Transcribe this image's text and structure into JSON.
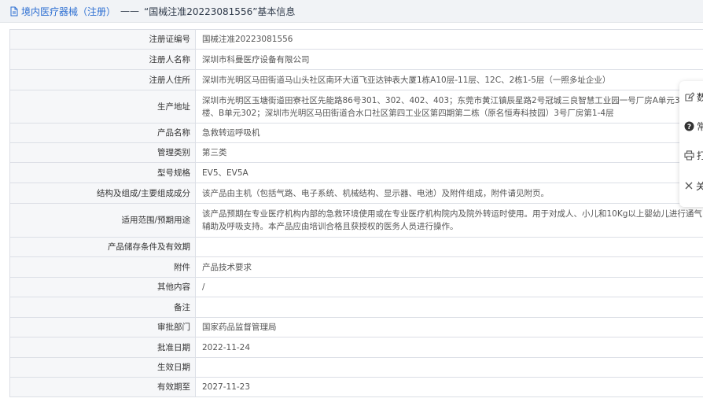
{
  "breadcrumb": {
    "category": "境内医疗器械（注册）",
    "separator": "——",
    "title": "“国械注准20223081556”基本信息"
  },
  "rows": [
    {
      "label": "注册证编号",
      "value": "国械注准20223081556"
    },
    {
      "label": "注册人名称",
      "value": "深圳市科曼医疗设备有限公司"
    },
    {
      "label": "注册人住所",
      "value": "深圳市光明区马田街道马山头社区南环大道飞亚达钟表大厦1栋A10层-11层、12C、2栋1-5层（一照多址企业）"
    },
    {
      "label": "生产地址",
      "value": "深圳市光明区玉塘街道田寮社区先能路86号301、302、402、403；东莞市黄江镇辰星路2号冠城三良智慧工业园一号厂房A单元3楼、4楼、B单元302；深圳市光明区马田街道合水口社区第四工业区第四期第二栋（原名恒寿科技园）3号厂房第1-4层"
    },
    {
      "label": "产品名称",
      "value": "急救转运呼吸机"
    },
    {
      "label": "管理类别",
      "value": "第三类"
    },
    {
      "label": "型号规格",
      "value": "EV5、EV5A"
    },
    {
      "label": "结构及组成/主要组成成分",
      "value": "该产品由主机（包括气路、电子系统、机械结构、显示器、电池）及附件组成，附件请见附页。"
    },
    {
      "label": "适用范围/预期用途",
      "value": "该产品预期在专业医疗机构内部的急救环境使用或在专业医疗机构院内及院外转运时使用。用于对成人、小儿和10Kg以上婴幼儿进行通气辅助及呼吸支持。本产品应由培训合格且获授权的医务人员进行操作。"
    },
    {
      "label": "产品储存条件及有效期",
      "value": ""
    },
    {
      "label": "附件",
      "value": "产品技术要求"
    },
    {
      "label": "其他内容",
      "value": "/"
    },
    {
      "label": "备注",
      "value": ""
    },
    {
      "label": "审批部门",
      "value": "国家药品监督管理局"
    },
    {
      "label": "批准日期",
      "value": "2022-11-24"
    },
    {
      "label": "生效日期",
      "value": ""
    },
    {
      "label": "有效期至",
      "value": "2027-11-23"
    }
  ],
  "float_menu": [
    {
      "icon": "edit-icon",
      "label": "数"
    },
    {
      "icon": "help-icon",
      "label": "常"
    },
    {
      "icon": "print-icon",
      "label": "打"
    },
    {
      "icon": "close-icon",
      "label": "关"
    }
  ]
}
